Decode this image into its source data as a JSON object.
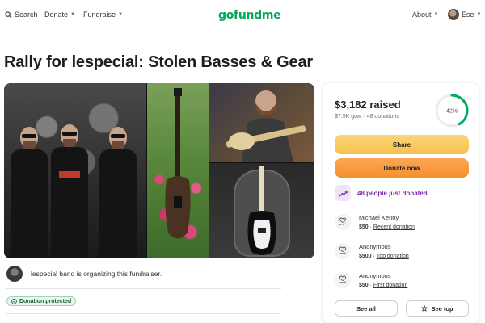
{
  "nav": {
    "search_label": "Search",
    "donate_label": "Donate",
    "fundraise_label": "Fundraise",
    "logo_text": "gofundme",
    "about_label": "About",
    "user_name": "Ese"
  },
  "campaign": {
    "title": "Rally for lespecial: Stolen Basses & Gear",
    "organizer_text": "lespecial band is organizing this fundraiser.",
    "protected_badge": "Donation protected"
  },
  "donation": {
    "raised": "$3,182 raised",
    "goal_line": "$7.5K goal · 48 donations",
    "progress_label": "42%",
    "progress_fraction": 0.42,
    "share_label": "Share",
    "donate_label": "Donate now",
    "recent_activity": "48 people just donated",
    "donors": [
      {
        "name": "Michael Kenny",
        "amount": "$50",
        "tag": "Recent donation"
      },
      {
        "name": "Anonymous",
        "amount": "$500",
        "tag": "Top donation"
      },
      {
        "name": "Anonymous",
        "amount": "$50",
        "tag": "First donation"
      }
    ],
    "see_all_label": "See all",
    "see_top_label": "See top"
  },
  "colors": {
    "brand": "#02a95c",
    "share_btn": "#f8c04d",
    "donate_btn": "#f68f2c",
    "recent_accent": "#7a2ca6"
  }
}
